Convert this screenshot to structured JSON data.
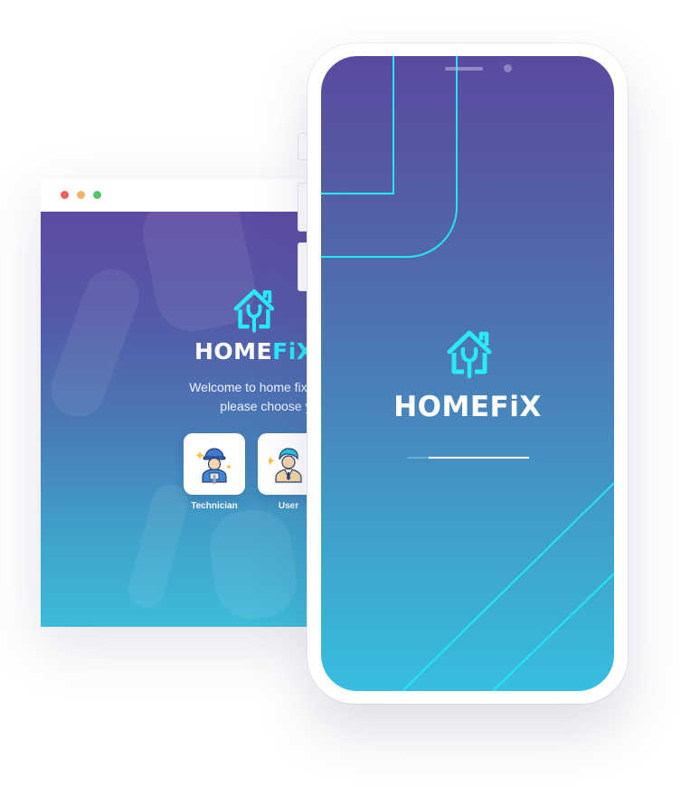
{
  "browser": {
    "brand_part1": "HOME",
    "brand_part2": "FiX",
    "welcome_line1": "Welcome to home fix hom",
    "welcome_line2": "please choose your w",
    "roles": [
      {
        "label": "Technician",
        "icon": "technician-avatar-icon"
      },
      {
        "label": "User",
        "icon": "user-avatar-icon"
      }
    ],
    "window_controls": [
      "close",
      "minimize",
      "maximize"
    ]
  },
  "phone": {
    "brand": "HOMEFiX",
    "loading_progress": 0.82
  },
  "colors": {
    "accent_cyan": "#28eaf8",
    "gradient_top": "#5a4a9f",
    "gradient_bottom": "#37bee0"
  }
}
